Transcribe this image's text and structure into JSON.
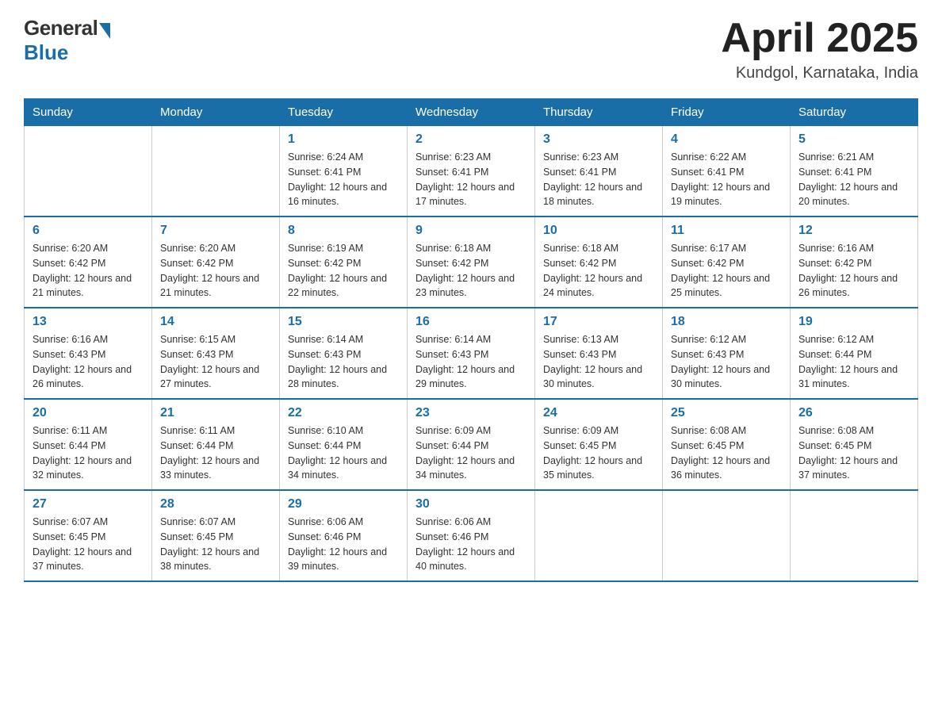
{
  "header": {
    "logo": {
      "general": "General",
      "blue": "Blue"
    },
    "title": "April 2025",
    "location": "Kundgol, Karnataka, India"
  },
  "days_of_week": [
    "Sunday",
    "Monday",
    "Tuesday",
    "Wednesday",
    "Thursday",
    "Friday",
    "Saturday"
  ],
  "weeks": [
    [
      {
        "day": "",
        "info": ""
      },
      {
        "day": "",
        "info": ""
      },
      {
        "day": "1",
        "info": "Sunrise: 6:24 AM\nSunset: 6:41 PM\nDaylight: 12 hours and 16 minutes."
      },
      {
        "day": "2",
        "info": "Sunrise: 6:23 AM\nSunset: 6:41 PM\nDaylight: 12 hours and 17 minutes."
      },
      {
        "day": "3",
        "info": "Sunrise: 6:23 AM\nSunset: 6:41 PM\nDaylight: 12 hours and 18 minutes."
      },
      {
        "day": "4",
        "info": "Sunrise: 6:22 AM\nSunset: 6:41 PM\nDaylight: 12 hours and 19 minutes."
      },
      {
        "day": "5",
        "info": "Sunrise: 6:21 AM\nSunset: 6:41 PM\nDaylight: 12 hours and 20 minutes."
      }
    ],
    [
      {
        "day": "6",
        "info": "Sunrise: 6:20 AM\nSunset: 6:42 PM\nDaylight: 12 hours and 21 minutes."
      },
      {
        "day": "7",
        "info": "Sunrise: 6:20 AM\nSunset: 6:42 PM\nDaylight: 12 hours and 21 minutes."
      },
      {
        "day": "8",
        "info": "Sunrise: 6:19 AM\nSunset: 6:42 PM\nDaylight: 12 hours and 22 minutes."
      },
      {
        "day": "9",
        "info": "Sunrise: 6:18 AM\nSunset: 6:42 PM\nDaylight: 12 hours and 23 minutes."
      },
      {
        "day": "10",
        "info": "Sunrise: 6:18 AM\nSunset: 6:42 PM\nDaylight: 12 hours and 24 minutes."
      },
      {
        "day": "11",
        "info": "Sunrise: 6:17 AM\nSunset: 6:42 PM\nDaylight: 12 hours and 25 minutes."
      },
      {
        "day": "12",
        "info": "Sunrise: 6:16 AM\nSunset: 6:42 PM\nDaylight: 12 hours and 26 minutes."
      }
    ],
    [
      {
        "day": "13",
        "info": "Sunrise: 6:16 AM\nSunset: 6:43 PM\nDaylight: 12 hours and 26 minutes."
      },
      {
        "day": "14",
        "info": "Sunrise: 6:15 AM\nSunset: 6:43 PM\nDaylight: 12 hours and 27 minutes."
      },
      {
        "day": "15",
        "info": "Sunrise: 6:14 AM\nSunset: 6:43 PM\nDaylight: 12 hours and 28 minutes."
      },
      {
        "day": "16",
        "info": "Sunrise: 6:14 AM\nSunset: 6:43 PM\nDaylight: 12 hours and 29 minutes."
      },
      {
        "day": "17",
        "info": "Sunrise: 6:13 AM\nSunset: 6:43 PM\nDaylight: 12 hours and 30 minutes."
      },
      {
        "day": "18",
        "info": "Sunrise: 6:12 AM\nSunset: 6:43 PM\nDaylight: 12 hours and 30 minutes."
      },
      {
        "day": "19",
        "info": "Sunrise: 6:12 AM\nSunset: 6:44 PM\nDaylight: 12 hours and 31 minutes."
      }
    ],
    [
      {
        "day": "20",
        "info": "Sunrise: 6:11 AM\nSunset: 6:44 PM\nDaylight: 12 hours and 32 minutes."
      },
      {
        "day": "21",
        "info": "Sunrise: 6:11 AM\nSunset: 6:44 PM\nDaylight: 12 hours and 33 minutes."
      },
      {
        "day": "22",
        "info": "Sunrise: 6:10 AM\nSunset: 6:44 PM\nDaylight: 12 hours and 34 minutes."
      },
      {
        "day": "23",
        "info": "Sunrise: 6:09 AM\nSunset: 6:44 PM\nDaylight: 12 hours and 34 minutes."
      },
      {
        "day": "24",
        "info": "Sunrise: 6:09 AM\nSunset: 6:45 PM\nDaylight: 12 hours and 35 minutes."
      },
      {
        "day": "25",
        "info": "Sunrise: 6:08 AM\nSunset: 6:45 PM\nDaylight: 12 hours and 36 minutes."
      },
      {
        "day": "26",
        "info": "Sunrise: 6:08 AM\nSunset: 6:45 PM\nDaylight: 12 hours and 37 minutes."
      }
    ],
    [
      {
        "day": "27",
        "info": "Sunrise: 6:07 AM\nSunset: 6:45 PM\nDaylight: 12 hours and 37 minutes."
      },
      {
        "day": "28",
        "info": "Sunrise: 6:07 AM\nSunset: 6:45 PM\nDaylight: 12 hours and 38 minutes."
      },
      {
        "day": "29",
        "info": "Sunrise: 6:06 AM\nSunset: 6:46 PM\nDaylight: 12 hours and 39 minutes."
      },
      {
        "day": "30",
        "info": "Sunrise: 6:06 AM\nSunset: 6:46 PM\nDaylight: 12 hours and 40 minutes."
      },
      {
        "day": "",
        "info": ""
      },
      {
        "day": "",
        "info": ""
      },
      {
        "day": "",
        "info": ""
      }
    ]
  ]
}
